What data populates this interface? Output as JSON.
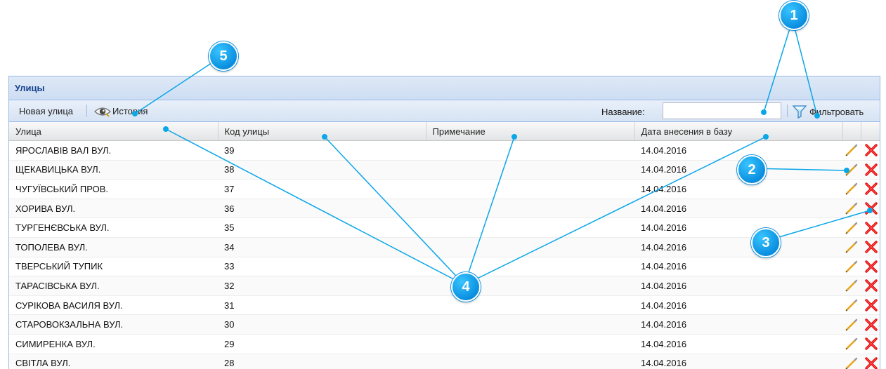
{
  "panel": {
    "title": "Улицы"
  },
  "toolbar": {
    "new_street_label": "Новая улица",
    "history_label": "История",
    "name_label": "Название:",
    "name_value": "",
    "filter_label": "Фильтровать"
  },
  "grid": {
    "columns": [
      "Улица",
      "Код улицы",
      "Примечание",
      "Дата внесения в базу"
    ],
    "rows": [
      {
        "street": "ЯРОСЛАВІВ ВАЛ ВУЛ.",
        "code": "39",
        "note": "",
        "date": "14.04.2016"
      },
      {
        "street": "ЩЕКАВИЦЬКА ВУЛ.",
        "code": "38",
        "note": "",
        "date": "14.04.2016"
      },
      {
        "street": "ЧУГУЇВСЬКИЙ ПРОВ.",
        "code": "37",
        "note": "",
        "date": "14.04.2016"
      },
      {
        "street": "ХОРИВА ВУЛ.",
        "code": "36",
        "note": "",
        "date": "14.04.2016"
      },
      {
        "street": "ТУРГЕНЄВСЬКА ВУЛ.",
        "code": "35",
        "note": "",
        "date": "14.04.2016"
      },
      {
        "street": "ТОПОЛЕВА ВУЛ.",
        "code": "34",
        "note": "",
        "date": "14.04.2016"
      },
      {
        "street": "ТВЕРСЬКИЙ ТУПИК",
        "code": "33",
        "note": "",
        "date": "14.04.2016"
      },
      {
        "street": "ТАРАСІВСЬКА ВУЛ.",
        "code": "32",
        "note": "",
        "date": "14.04.2016"
      },
      {
        "street": "СУРІКОВА ВАСИЛЯ ВУЛ.",
        "code": "31",
        "note": "",
        "date": "14.04.2016"
      },
      {
        "street": "СТАРОВОКЗАЛЬНА ВУЛ.",
        "code": "30",
        "note": "",
        "date": "14.04.2016"
      },
      {
        "street": "СИМИРЕНКА ВУЛ.",
        "code": "29",
        "note": "",
        "date": "14.04.2016"
      },
      {
        "street": "СВІТЛА ВУЛ.",
        "code": "28",
        "note": "",
        "date": "14.04.2016"
      }
    ]
  },
  "annotations": [
    "1",
    "2",
    "3",
    "4",
    "5"
  ],
  "icons": {
    "history": "eye-icon",
    "filter": "funnel-icon",
    "edit": "pencil-icon",
    "delete": "red-x-icon"
  },
  "colors": {
    "panel_border": "#99bbe8",
    "title_text": "#15428b",
    "marker_blue": "#0a8fe0",
    "annotation_line": "#0aa6e8",
    "delete_red": "#e00000",
    "edit_orange": "#f0b030"
  }
}
